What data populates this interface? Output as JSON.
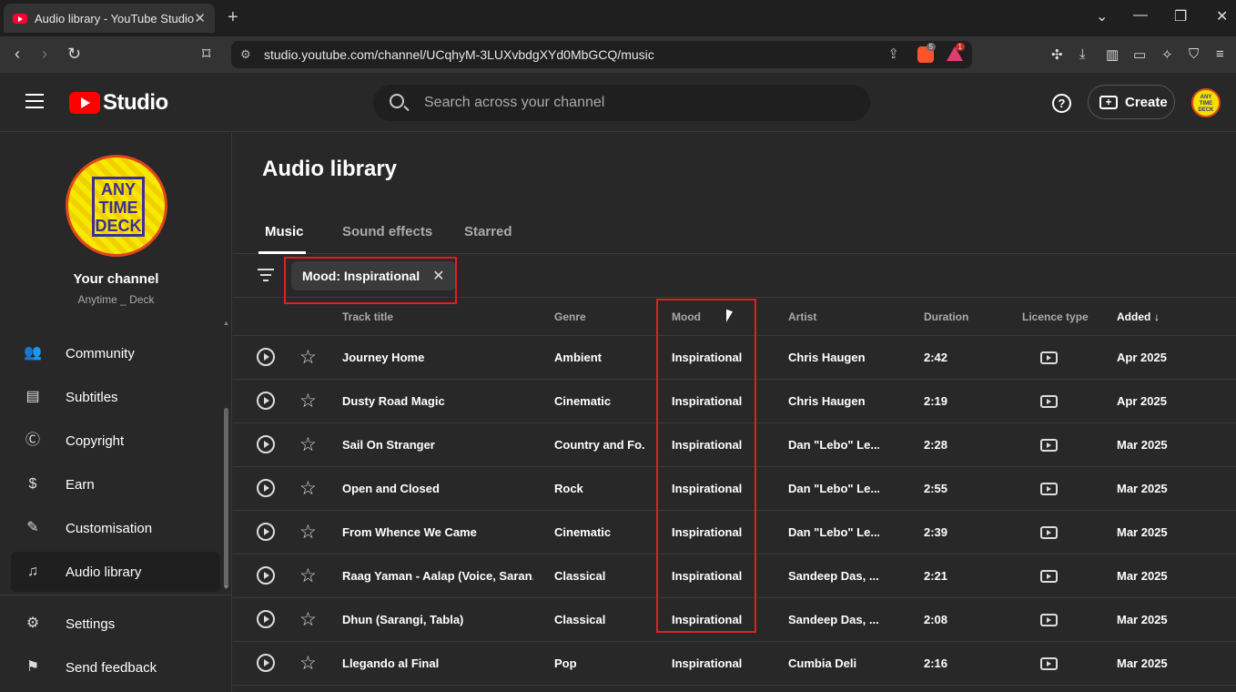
{
  "browser": {
    "tab_title": "Audio library - YouTube Studio",
    "url": "studio.youtube.com/channel/UCqhyM-3LUXvbdgXYd0MbGCQ/music",
    "brave_badge": "5",
    "alert_badge": "1"
  },
  "header": {
    "logo_text": "Studio",
    "search_placeholder": "Search across your channel",
    "help_glyph": "?",
    "create_label": "Create",
    "avatar_text": "ANY TIME DECK"
  },
  "sidebar": {
    "avatar_lines": [
      "ANY",
      "TIME",
      "DECK"
    ],
    "your_channel": "Your channel",
    "channel_name": "Anytime _ Deck",
    "items": [
      {
        "label": "Community",
        "icon": "community-icon"
      },
      {
        "label": "Subtitles",
        "icon": "subtitles-icon"
      },
      {
        "label": "Copyright",
        "icon": "copyright-icon"
      },
      {
        "label": "Earn",
        "icon": "earn-icon"
      },
      {
        "label": "Customisation",
        "icon": "customisation-icon"
      },
      {
        "label": "Audio library",
        "icon": "audio-library-icon"
      },
      {
        "label": "Settings",
        "icon": "settings-icon"
      },
      {
        "label": "Send feedback",
        "icon": "feedback-icon"
      }
    ]
  },
  "main": {
    "title": "Audio library",
    "tabs": [
      "Music",
      "Sound effects",
      "Starred"
    ],
    "filter_chip": "Mood: Inspirational",
    "columns": {
      "track_title": "Track title",
      "genre": "Genre",
      "mood": "Mood",
      "artist": "Artist",
      "duration": "Duration",
      "licence_type": "Licence type",
      "added": "Added"
    },
    "rows": [
      {
        "title": "Journey Home",
        "genre": "Ambient",
        "mood": "Inspirational",
        "artist": "Chris Haugen",
        "duration": "2:42",
        "added": "Apr 2025"
      },
      {
        "title": "Dusty Road Magic",
        "genre": "Cinematic",
        "mood": "Inspirational",
        "artist": "Chris Haugen",
        "duration": "2:19",
        "added": "Apr 2025"
      },
      {
        "title": "Sail On Stranger",
        "genre": "Country and Fo...",
        "mood": "Inspirational",
        "artist": "Dan \"Lebo\" Le...",
        "duration": "2:28",
        "added": "Mar 2025"
      },
      {
        "title": "Open and Closed",
        "genre": "Rock",
        "mood": "Inspirational",
        "artist": "Dan \"Lebo\" Le...",
        "duration": "2:55",
        "added": "Mar 2025"
      },
      {
        "title": "From Whence We Came",
        "genre": "Cinematic",
        "mood": "Inspirational",
        "artist": "Dan \"Lebo\" Le...",
        "duration": "2:39",
        "added": "Mar 2025"
      },
      {
        "title": "Raag Yaman - Aalap (Voice, Saran...",
        "genre": "Classical",
        "mood": "Inspirational",
        "artist": "Sandeep Das, ...",
        "duration": "2:21",
        "added": "Mar 2025"
      },
      {
        "title": "Dhun (Sarangi, Tabla)",
        "genre": "Classical",
        "mood": "Inspirational",
        "artist": "Sandeep Das, ...",
        "duration": "2:08",
        "added": "Mar 2025"
      },
      {
        "title": "Llegando al Final",
        "genre": "Pop",
        "mood": "Inspirational",
        "artist": "Cumbia Deli",
        "duration": "2:16",
        "added": "Mar 2025"
      }
    ]
  },
  "colors": {
    "background": "#282828",
    "highlight_box": "#e02020",
    "youtube_red": "#ff0000"
  }
}
